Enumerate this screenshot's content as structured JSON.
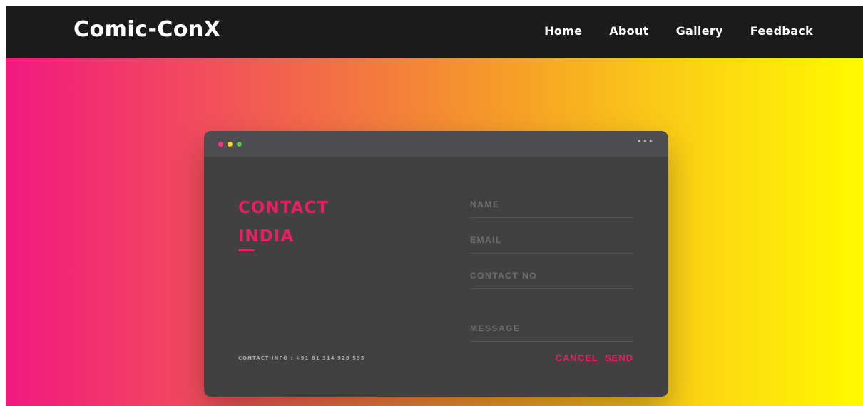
{
  "header": {
    "brand": "Comic-ConX",
    "nav": [
      {
        "label": "Home"
      },
      {
        "label": "About"
      },
      {
        "label": "Gallery"
      },
      {
        "label": "Feedback"
      }
    ]
  },
  "colors": {
    "navbar": "#1b1b1b",
    "gradient_start": "#f1197f",
    "gradient_end": "#fffa00",
    "card": "#414141",
    "accent": "#ea1e63"
  },
  "card": {
    "window_dots": [
      "pink",
      "yellow",
      "green"
    ],
    "menu_icon": "more-horizontal-icon",
    "menu_text": "•••",
    "title_line1": "CONTACT",
    "title_line2": "INDIA",
    "contact_info": "CONTACT INFO : +91 81 314 928 595",
    "form": {
      "name_placeholder": "NAME",
      "email_placeholder": "EMAIL",
      "phone_placeholder": "CONTACT NO",
      "message_placeholder": "MESSAGE",
      "cancel_label": "CANCEL",
      "send_label": "SEND"
    }
  }
}
